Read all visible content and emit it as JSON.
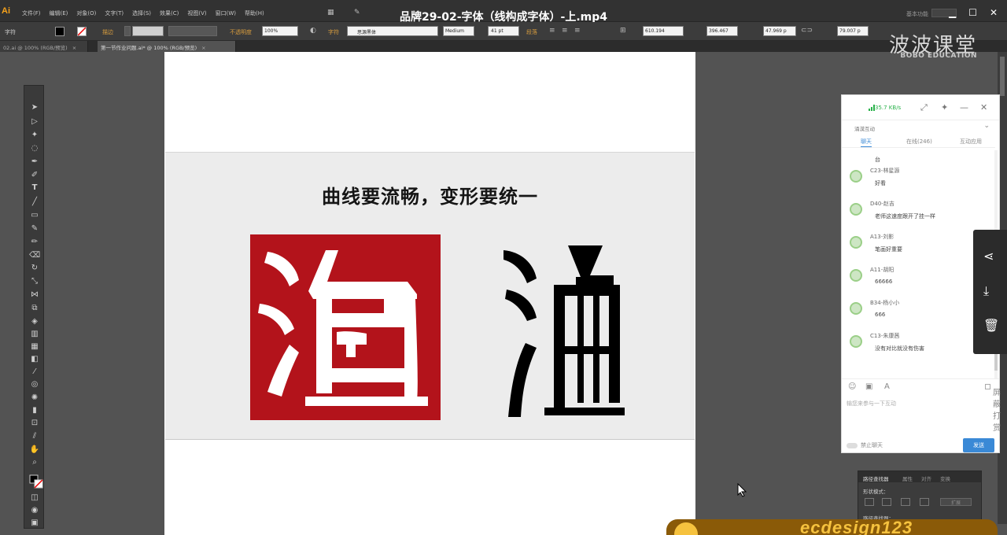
{
  "app": {
    "logo": "Ai",
    "window_title": "品牌29-02-字体（线构成字体）-上.mp4"
  },
  "menus": [
    "文件(F)",
    "编辑(E)",
    "对象(O)",
    "文字(T)",
    "选择(S)",
    "效果(C)",
    "视图(V)",
    "窗口(W)",
    "帮助(H)"
  ],
  "workspace": "基本功能",
  "control": {
    "type_label": "字符",
    "stroke_label": "描边",
    "opacity_label": "不透明度",
    "opacity_value": "100%",
    "char_label": "字符",
    "font_value": "思源黑体",
    "style_value": "Medium",
    "size_value": "41 pt",
    "para_label": "段落",
    "x_value": "610.194",
    "y_value": "396.467",
    "w_value": "47.969 p",
    "h_value": "79.007 p"
  },
  "tabs": [
    {
      "label": "02.ai @ 100% (RGB/预览)"
    },
    {
      "label": "第一节作业问题.ai* @ 100% (RGB/预览)"
    }
  ],
  "canvas": {
    "heading": "曲线要流畅，变形要统一",
    "char": "海"
  },
  "watermark": {
    "cn": "波波课堂",
    "en": "BOBO EDUCATION"
  },
  "chat": {
    "speed": "35.7 KB/s",
    "section": "涌漠互动",
    "tabs": [
      "聊天",
      "在线(246)",
      "互动应用"
    ],
    "messages": [
      {
        "name": "",
        "text": "台"
      },
      {
        "name": "C23-林星源",
        "text": "好看"
      },
      {
        "name": "D40-赵吉",
        "text": "老师这速度跟开了挂一样"
      },
      {
        "name": "A13-刘影",
        "text": "笔画好重要"
      },
      {
        "name": "A11-胡阳",
        "text": "66666"
      },
      {
        "name": "B34-杨小小",
        "text": "666"
      },
      {
        "name": "C13-朱康茜",
        "text": "没有对比就没有伤害"
      }
    ],
    "ban_label": "屏蔽打赏",
    "input_placeholder": "输您来参与一下互动",
    "mute_label": "禁止聊天",
    "send_label": "发送"
  },
  "panel": {
    "tabs": [
      "路径查找器",
      "属性",
      "对齐",
      "变换"
    ],
    "row1": "形状模式：",
    "expand": "扩展",
    "row2": "路径查找器："
  },
  "banner": {
    "text": "ecdesign123"
  }
}
